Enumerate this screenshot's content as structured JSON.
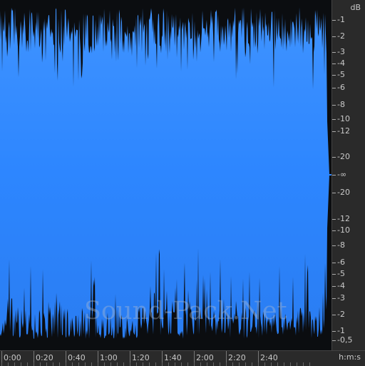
{
  "colors": {
    "wave": "#2d86ff",
    "background": "#0b0d10",
    "ruler": "#2a2a2a",
    "text": "#c9c9c9"
  },
  "db_scale": {
    "unit": "dB",
    "ticks_top": [
      "-1",
      "-2",
      "-3",
      "-4",
      "-5",
      "-6",
      "-8",
      "-10",
      "-12",
      "-20",
      "-∞"
    ],
    "ticks_bottom": [
      "-20",
      "-12",
      "-10",
      "-8",
      "-6",
      "-5",
      "-4",
      "-3",
      "-2",
      "-1",
      "-0,5"
    ]
  },
  "time_ruler": {
    "unit": "h:m:s",
    "labels": [
      "0:00",
      "0:20",
      "0:40",
      "1:00",
      "1:20",
      "1:40",
      "2:00",
      "2:20",
      "2:40"
    ]
  },
  "watermark": "Sound-Pack.Net"
}
